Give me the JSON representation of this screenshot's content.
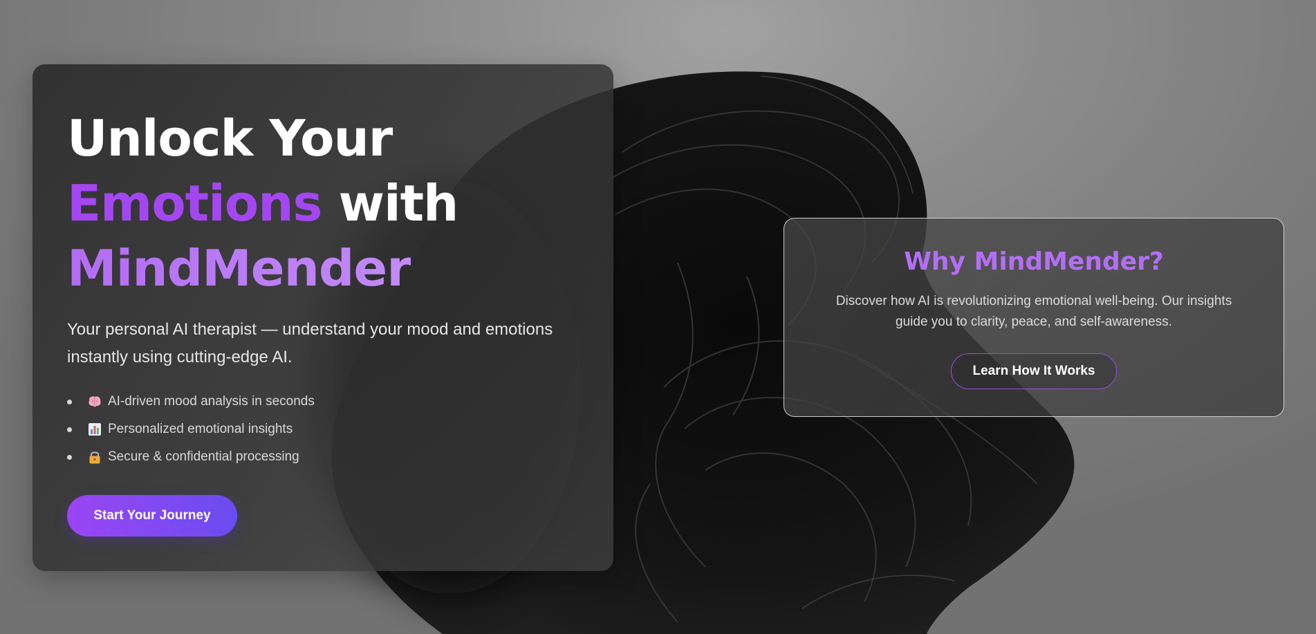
{
  "hero": {
    "title_line1": "Unlock Your",
    "title_accent": "Emotions",
    "title_with": "with",
    "title_brand": "MindMender",
    "subtitle": "Your personal AI therapist — understand your mood and emotions instantly using cutting-edge AI.",
    "features": [
      {
        "icon": "brain-icon",
        "label": "AI-driven mood analysis in seconds"
      },
      {
        "icon": "bar-chart-icon",
        "label": "Personalized emotional insights"
      },
      {
        "icon": "lock-icon",
        "label": "Secure & confidential processing"
      }
    ],
    "cta_label": "Start Your Journey"
  },
  "info": {
    "title": "Why MindMender?",
    "text": "Discover how AI is revolutionizing emotional well-being. Our insights guide you to clarity, peace, and self-awareness.",
    "cta_label": "Learn How It Works"
  },
  "colors": {
    "accent_purple": "#a447f2",
    "accent_light_purple": "#b46ef5",
    "button_gradient_start": "#9b46f4",
    "button_gradient_end": "#6a4cf0"
  }
}
